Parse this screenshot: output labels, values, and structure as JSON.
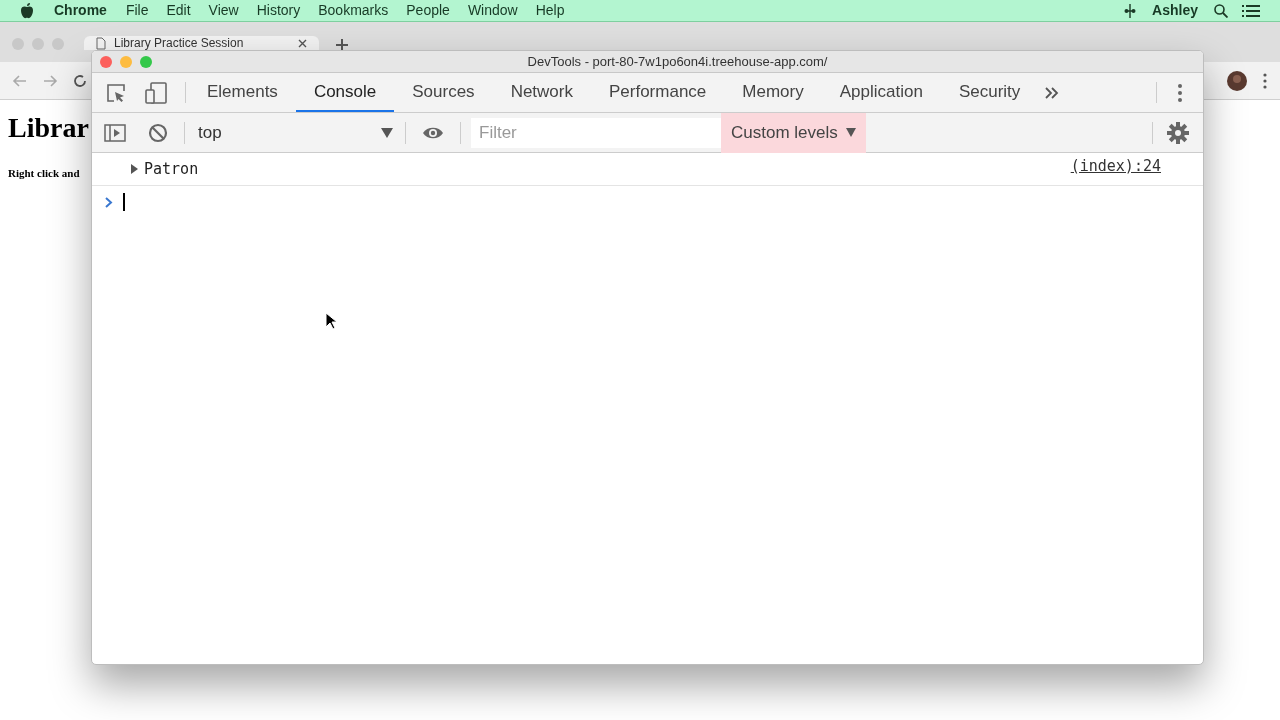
{
  "menu_bar": {
    "app": "Chrome",
    "items": [
      "File",
      "Edit",
      "View",
      "History",
      "Bookmarks",
      "People",
      "Window",
      "Help"
    ],
    "user": "Ashley"
  },
  "browser": {
    "tab": {
      "title": "Library Practice Session"
    },
    "page": {
      "heading": "Librar",
      "text": "Right click and"
    }
  },
  "devtools": {
    "title": "DevTools - port-80-7w1po6on4i.treehouse-app.com/",
    "tabs": [
      {
        "label": "Elements",
        "selected": false
      },
      {
        "label": "Console",
        "selected": true
      },
      {
        "label": "Sources",
        "selected": false
      },
      {
        "label": "Network",
        "selected": false
      },
      {
        "label": "Performance",
        "selected": false
      },
      {
        "label": "Memory",
        "selected": false
      },
      {
        "label": "Application",
        "selected": false
      },
      {
        "label": "Security",
        "selected": false
      }
    ],
    "context": "top",
    "filter": {
      "placeholder": "Filter"
    },
    "levels": "Custom levels",
    "messages": [
      {
        "text": "Patron",
        "expanded": false,
        "source": "(index):24"
      }
    ]
  }
}
